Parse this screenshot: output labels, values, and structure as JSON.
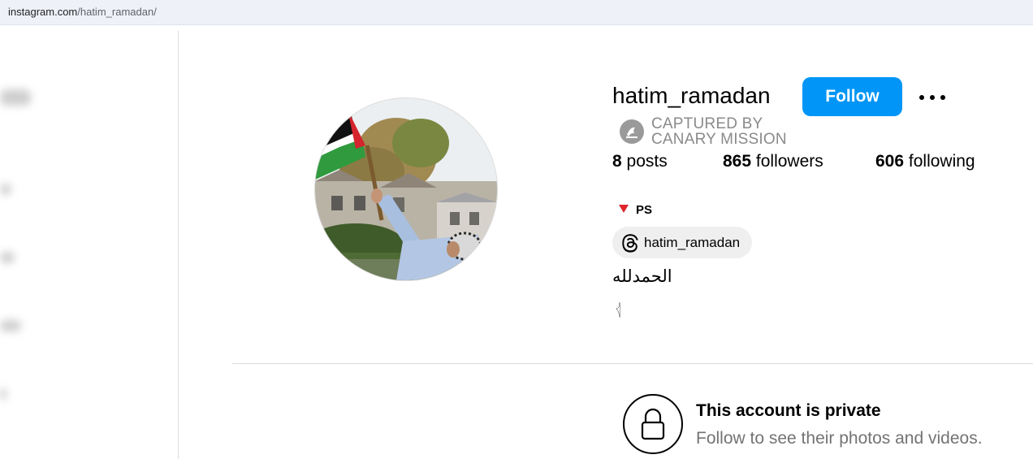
{
  "browser": {
    "url_domain": "instagram.com",
    "url_path": "/hatim_ramadan/"
  },
  "profile": {
    "username": "hatim_ramadan",
    "follow_label": "Follow",
    "watermark": {
      "line1": "CAPTURED BY",
      "line2": "CANARY MISSION"
    },
    "stats": {
      "posts_count": "8",
      "posts_label": "posts",
      "followers_count": "865",
      "followers_label": "followers",
      "following_count": "606",
      "following_label": "following"
    },
    "location_label": "PS",
    "threads_handle": "hatim_ramadan",
    "bio_line1": "الحمدلله",
    "bio_line2": "𓂆"
  },
  "private_notice": {
    "title": "This account is private",
    "subtitle": "Follow to see their photos and videos."
  },
  "colors": {
    "follow_button": "#0095f6",
    "flag_marker": "#e0242b",
    "watermark_text": "#8a8a8a",
    "secondary_text": "#737373"
  },
  "icons": [
    "more-options-icon",
    "canary-mission-logo-icon",
    "red-triangle-icon",
    "threads-icon",
    "lock-icon"
  ]
}
